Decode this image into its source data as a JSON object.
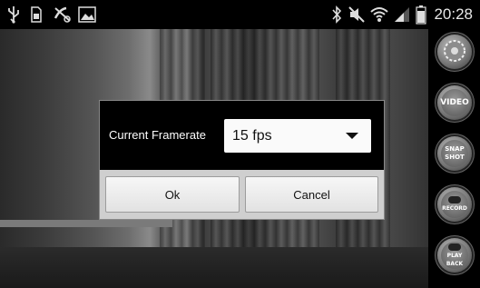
{
  "status_bar": {
    "left_icons": [
      "usb-icon",
      "sd-card-icon",
      "no-signal-call-icon",
      "image-icon"
    ],
    "right_icons": [
      "bluetooth-icon",
      "mute-icon",
      "wifi-icon",
      "signal-icon",
      "battery-icon"
    ],
    "time": "20:28"
  },
  "side_toolbar": {
    "buttons": [
      {
        "icon": "settings-gear-icon",
        "label": ""
      },
      {
        "icon": "video-icon",
        "label": "VIDEO"
      },
      {
        "icon": "snapshot-icon",
        "label": "SNAP SHOT"
      },
      {
        "icon": "record-icon",
        "label": "RECORD"
      },
      {
        "icon": "playback-icon",
        "label": "PLAY BACK"
      }
    ]
  },
  "dialog": {
    "framerate_label": "Current Framerate",
    "framerate_value": "15 fps",
    "ok_label": "Ok",
    "cancel_label": "Cancel"
  }
}
